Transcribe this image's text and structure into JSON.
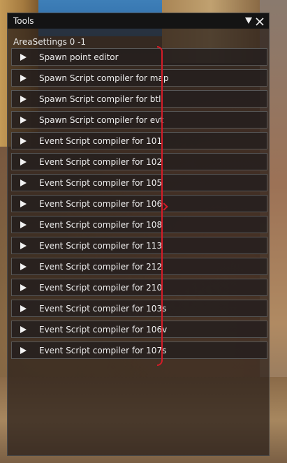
{
  "window": {
    "title": "Tools"
  },
  "section": {
    "label": "AreaSettings 0 -1"
  },
  "items": [
    {
      "label": "Spawn point editor"
    },
    {
      "label": "Spawn Script compiler for map"
    },
    {
      "label": "Spawn Script compiler for btl"
    },
    {
      "label": "Spawn Script compiler for evt"
    },
    {
      "label": "Event Script compiler for 101"
    },
    {
      "label": "Event Script compiler for 102"
    },
    {
      "label": "Event Script compiler for 105"
    },
    {
      "label": "Event Script compiler for 106"
    },
    {
      "label": "Event Script compiler for 108"
    },
    {
      "label": "Event Script compiler for 113"
    },
    {
      "label": "Event Script compiler for 212"
    },
    {
      "label": "Event Script compiler for 210"
    },
    {
      "label": "Event Script compiler for 103s"
    },
    {
      "label": "Event Script compiler for 106v"
    },
    {
      "label": "Event Script compiler for 107s"
    }
  ],
  "icons": {
    "collapse": "triangle-down-icon",
    "close": "close-icon",
    "expand": "play-arrow-icon"
  },
  "colors": {
    "annotation_bracket": "#d41c28",
    "titlebar": "#141414",
    "panel_text": "#eeeeee"
  }
}
